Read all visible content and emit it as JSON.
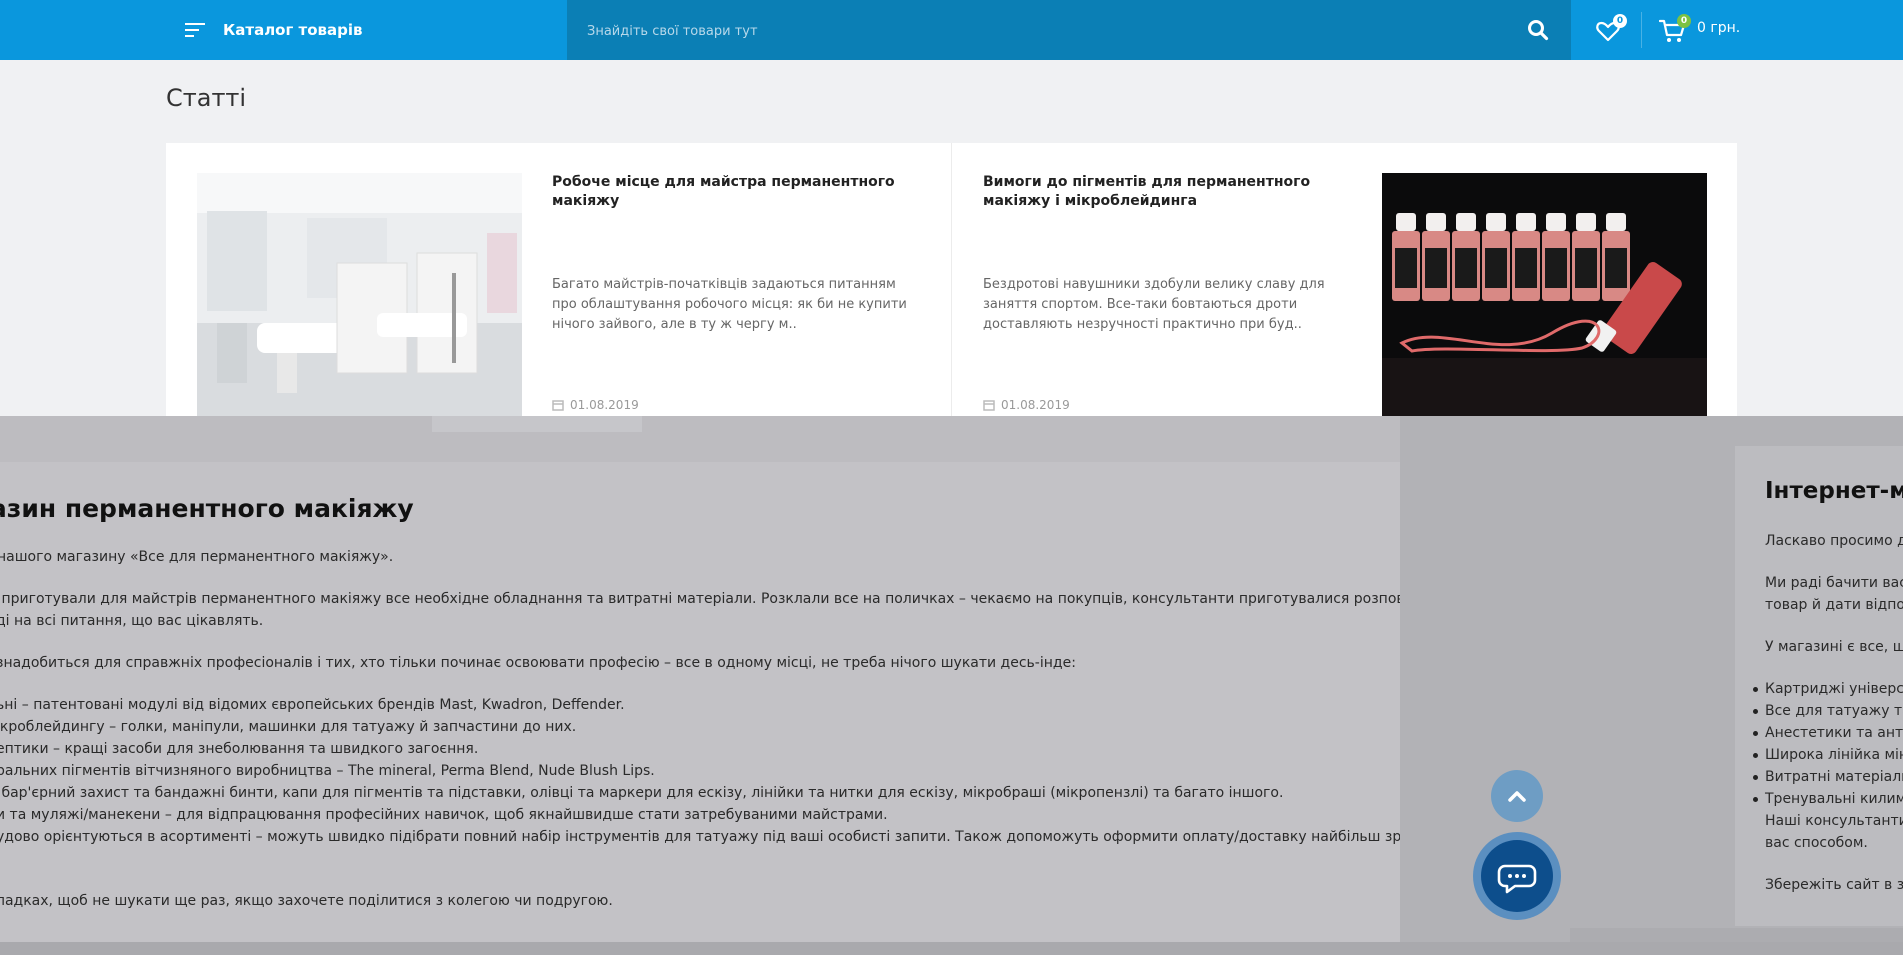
{
  "header": {
    "catalog_label": "Каталог товарів",
    "search_placeholder": "Знайдіть свої товари тут",
    "wishlist_count": "0",
    "cart_count": "0",
    "cart_total": "0 грн."
  },
  "articles_section": {
    "title": "Статті",
    "items": [
      {
        "title": "Робоче місце для майстра перманентного макіяжу",
        "excerpt": "Багато майстрів-початківців задаються питанням про облаштування робочого місця: як би не купити нічого зайвого, але в ту ж чергу м..",
        "date": "01.08.2019"
      },
      {
        "title": "Вимоги до пігментів для перманентного макіяжу і мікроблейдинга",
        "excerpt": "Бездротові навушники здобули велику славу для заняття спортом. Все-таки бовтаються дроти доставляють незручності практично при буд..",
        "date": "01.08.2019"
      }
    ]
  },
  "seo_main": {
    "title": "агазин перманентного макіяжу",
    "lines": [
      "нашого магазину «Все для перманентного макіяжу».",
      "– приготували для майстрів перманентного макіяжу все необхідне обладнання та витратні матеріали. Розклали все на поличках – чекаємо на покупців, консультанти приготувалися розповісти про",
      "ді на всі питання, що вас цікавлять.",
      "знадобиться для справжніх професіоналів і тих, хто тільки починає освоювати професію – все в одному місці, не треба нічого шукати десь-інде:",
      "ьні – патентовані модулі від відомих європейських брендів Mast, Kwadron, Deffender.",
      "ікроблейдингу – голки, маніпули, машинки для татуажу й запчастини до них.",
      "ептики – кращі засоби для знеболювання та швидкого загоєння.",
      "ральних пігментів вітчизняного виробництва – The mineral, Perma Blend, Nude Blush Lips.",
      "– бар'єрний захист та бандажні бинти, капи для пігментів та підставки, олівці та маркери для ескізу, лінійки та нитки для ескізу, мікробраші (мікропензлі) та багато іншого.",
      "и та муляжі/манекени – для відпрацювання професійних навичок, щоб якнайшвидше стати затребуваними майстрами.",
      "удово орієнтуються в асортименті – можуть швидко підібрати повний набір інструментів для татуажу під ваші особисті запити. Також допоможуть оформити оплату/доставку найбільш зручним для",
      "ладках, щоб не шукати ще раз, якщо захочете поділитися з колегою чи подругою."
    ]
  },
  "seo_right": {
    "title": "Інтернет-м",
    "lines": [
      "Ласкаво просимо до",
      "Ми раді бачити вас -",
      "товар й дати відпові",
      "У магазині є все, що",
      "Картриджі універсал",
      "Все для татуажу та м",
      "Анестетики та антис",
      "Широка лінійка міне",
      "Витратні матеріали -",
      "Тренувальні килимк",
      "Наші консультанти ч",
      "вас способом.",
      "Збережіть сайт в зак"
    ]
  },
  "colors": {
    "header_blue": "#0a97dd",
    "search_blue": "#0b7fb5",
    "badge_green": "#7cc243",
    "overlay_gray": "#c3c2c6",
    "chat_button": "#0d4e8c"
  }
}
